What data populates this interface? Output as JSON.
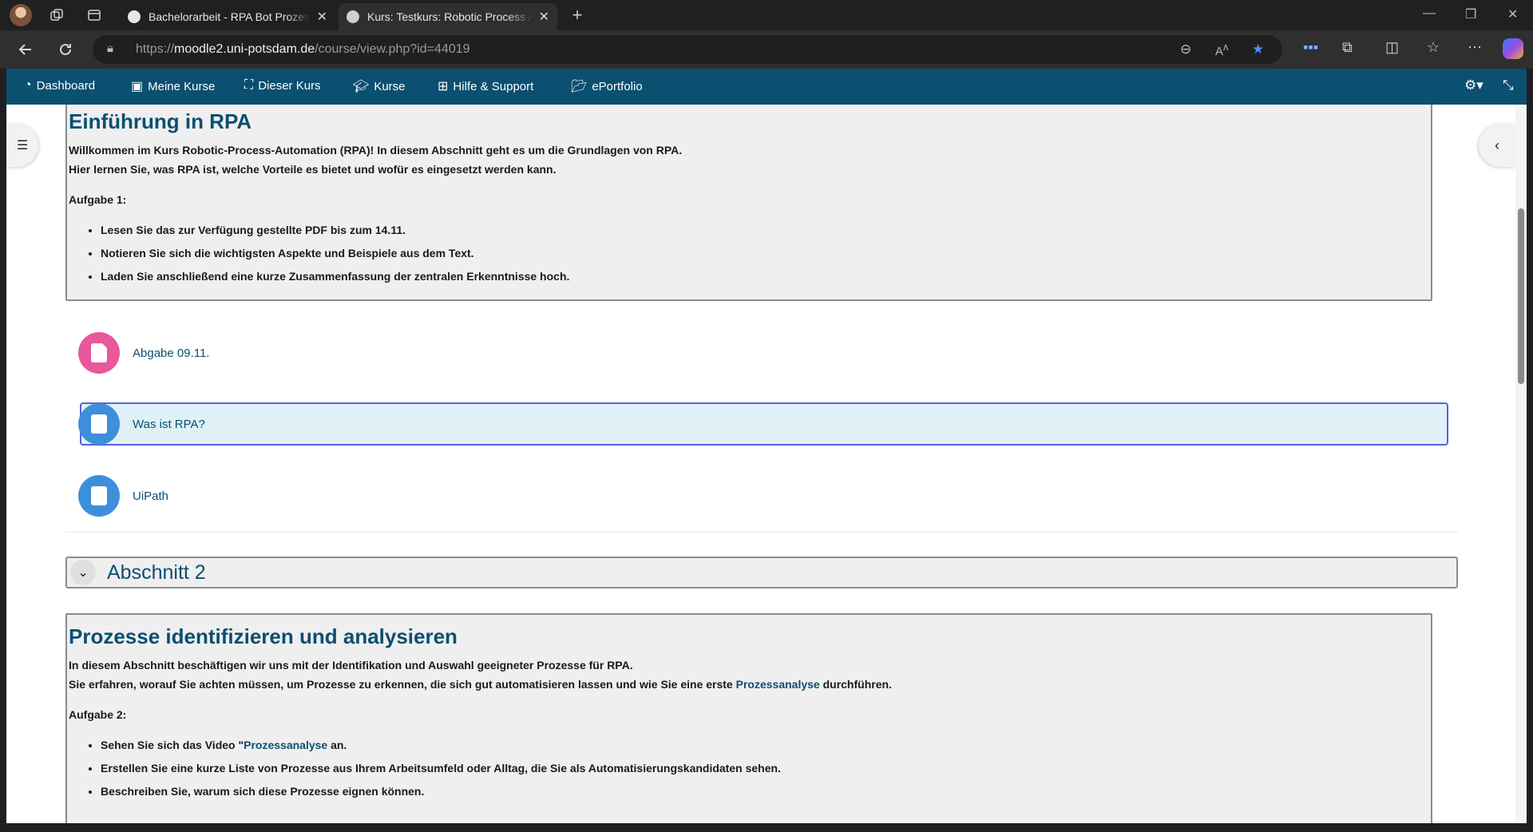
{
  "browser": {
    "tabs": [
      {
        "title": "Bachelorarbeit - RPA Bot Prozessb",
        "active": false
      },
      {
        "title": "Kurs: Testkurs: Robotic Process Au",
        "active": true
      }
    ],
    "new_tab": "+",
    "url_domain": "moodle2.uni-potsdam.de",
    "url_prefix": "https://",
    "url_path": "/course/view.php?id=44019"
  },
  "navbar": {
    "items": [
      {
        "label": "Dashboard",
        "icon": "dashboard-icon"
      },
      {
        "label": "Meine Kurse",
        "icon": "briefcase-icon"
      },
      {
        "label": "Dieser Kurs",
        "icon": "sitemap-icon"
      },
      {
        "label": "Kurse",
        "icon": "graduation-cap-icon"
      },
      {
        "label": "Hilfe & Support",
        "icon": "medkit-icon"
      },
      {
        "label": "ePortfolio",
        "icon": "folder-open-icon"
      }
    ]
  },
  "section1": {
    "title": "Einführung in RPA",
    "intro1": "Willkommen im Kurs Robotic-Process-Automation (RPA)! In diesem Abschnitt geht es um die Grundlagen von RPA.",
    "intro2": "Hier lernen Sie, was RPA ist, welche Vorteile es bietet und wofür es eingesetzt werden kann.",
    "task_label": "Aufgabe 1:",
    "tasks": [
      "Lesen Sie das zur Verfügung gestellte PDF bis zum 14.11.",
      "Notieren Sie sich die wichtigsten Aspekte und Beispiele aus dem Text.",
      "Laden Sie anschließend eine kurze Zusammenfassung der zentralen Erkenntnisse hoch."
    ],
    "activities": [
      {
        "name": "Abgabe 09.11.",
        "type": "assignment",
        "color": "#e8589a"
      },
      {
        "name": "Was ist RPA?",
        "type": "page",
        "color": "#3d8fd9"
      },
      {
        "name": "UiPath",
        "type": "page",
        "color": "#3d8fd9"
      }
    ]
  },
  "section2": {
    "header": "Abschnitt 2",
    "title": "Prozesse identifizieren und analysieren",
    "intro1": "In diesem Abschnitt beschäftigen wir uns mit der Identifikation und Auswahl geeigneter Prozesse für RPA.",
    "intro2_before": "Sie erfahren, worauf Sie achten müssen, um Prozesse zu erkennen, die sich gut automatisieren lassen und wie Sie eine erste ",
    "intro2_link": "Prozessanalyse",
    "intro2_after": " durchführen.",
    "task_label": "Aufgabe 2:",
    "task1_before": "Sehen Sie sich das Video \"",
    "task1_link": "Prozessanalyse",
    "task1_after": " an.",
    "task2": "Erstellen Sie eine kurze Liste von Prozesse aus Ihrem Arbeitsumfeld oder Alltag, die Sie als Automatisierungskandidaten sehen.",
    "task3": "Beschreiben Sie, warum sich diese Prozesse eignen können."
  },
  "colors": {
    "brand": "#0b4f71",
    "assignment": "#e8589a",
    "resource": "#3d8fd9"
  }
}
